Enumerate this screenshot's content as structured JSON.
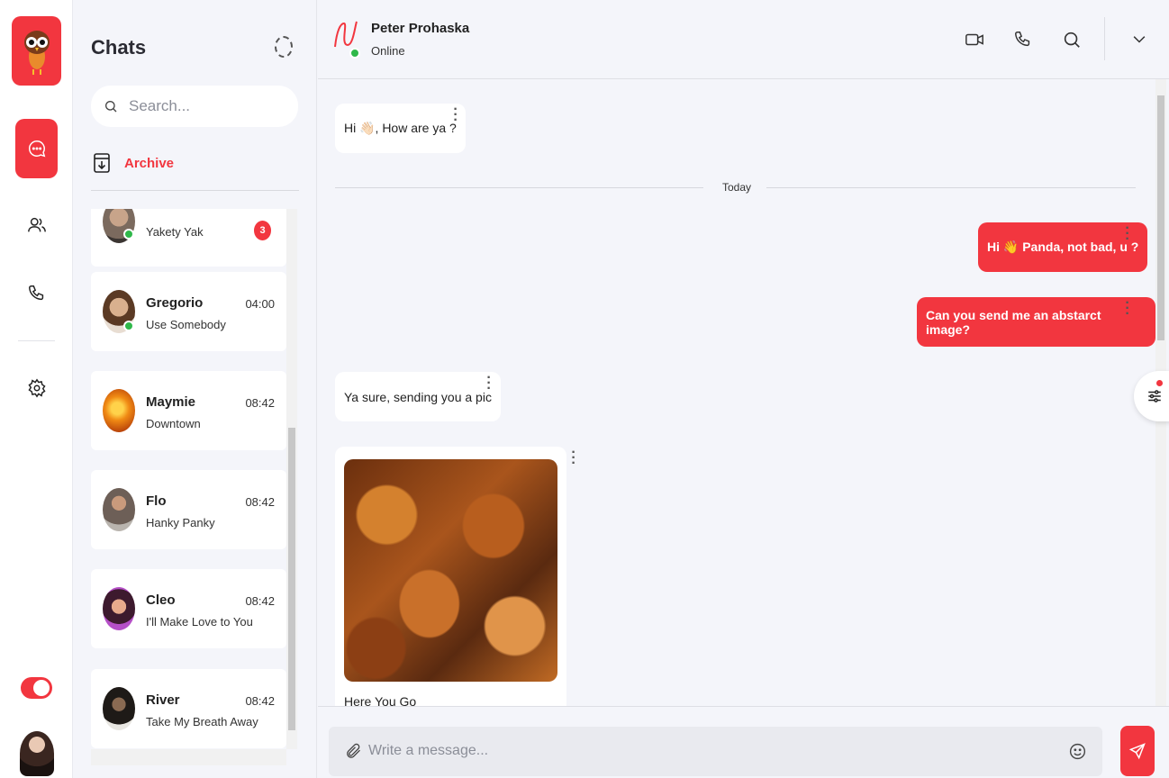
{
  "colors": {
    "accent": "#f2363f",
    "online": "#2fb84a",
    "background": "#f4f5fa"
  },
  "rail": {
    "icons": [
      "owl-logo-icon",
      "chat-icon",
      "users-icon",
      "phone-icon",
      "settings-icon"
    ],
    "theme_toggle_on": true
  },
  "chats": {
    "title": "Chats",
    "search_placeholder": "Search...",
    "archive_label": "Archive",
    "items": [
      {
        "name": "",
        "message": "Yakety Yak",
        "time": "",
        "badge": "3",
        "online": true
      },
      {
        "name": "Gregorio",
        "message": "Use Somebody",
        "time": "04:00",
        "online": true
      },
      {
        "name": "Maymie",
        "message": "Downtown",
        "time": "08:42",
        "online": false
      },
      {
        "name": "Flo",
        "message": "Hanky Panky",
        "time": "08:42",
        "online": false
      },
      {
        "name": "Cleo",
        "message": "I'll Make Love to You",
        "time": "08:42",
        "online": false
      },
      {
        "name": "River",
        "message": "Take My Breath Away",
        "time": "08:42",
        "online": false
      }
    ]
  },
  "conversation": {
    "contact_name": "Peter Prohaska",
    "contact_status": "Online",
    "header_icons": [
      "video-call-icon",
      "voice-call-icon",
      "search-icon",
      "chevron-down-icon"
    ],
    "day_separator": "Today",
    "messages": [
      {
        "direction": "incoming",
        "text": "Hi 👋🏻, How are ya ?"
      },
      {
        "direction": "outgoing",
        "text": "Hi 👋 Panda, not bad, u ?"
      },
      {
        "direction": "outgoing",
        "text": "Can you send me an abstarct image?"
      },
      {
        "direction": "incoming",
        "text": "Ya sure, sending you a pic"
      },
      {
        "direction": "incoming",
        "type": "image",
        "caption": "Here You Go"
      }
    ],
    "composer_placeholder": "Write a message..."
  }
}
